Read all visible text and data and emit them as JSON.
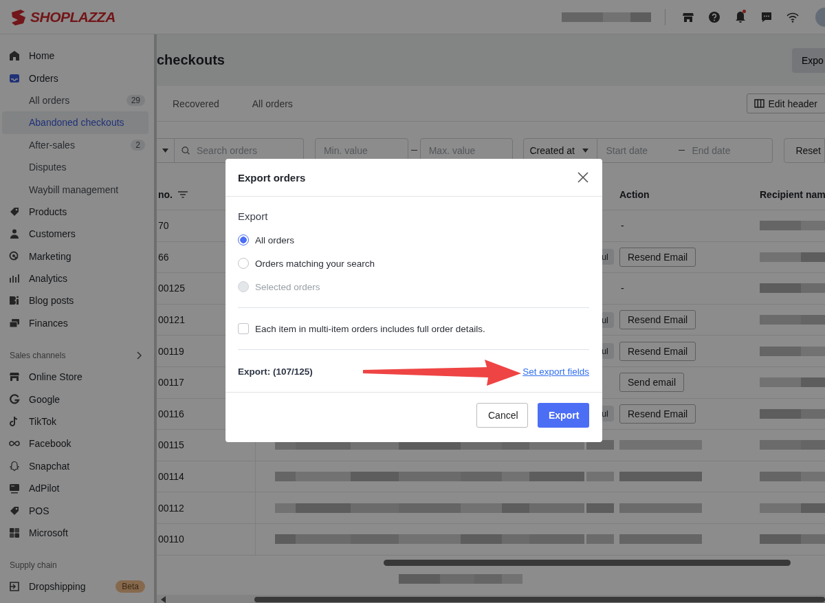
{
  "topbar": {
    "brand": "SHOPLAZZA",
    "unread_notifications": true
  },
  "sidebar": {
    "items": [
      {
        "label": "Home",
        "selected": false
      },
      {
        "label": "Orders",
        "selected": false,
        "children": [
          {
            "label": "All orders",
            "count": "29",
            "selected": false
          },
          {
            "label": "Abandoned checkouts",
            "selected": true
          },
          {
            "label": "After-sales",
            "count": "2",
            "selected": false
          },
          {
            "label": "Disputes",
            "selected": false
          },
          {
            "label": "Waybill management",
            "selected": false
          }
        ]
      },
      {
        "label": "Products",
        "selected": false
      },
      {
        "label": "Customers",
        "selected": false
      },
      {
        "label": "Marketing",
        "selected": false
      },
      {
        "label": "Analytics",
        "selected": false
      },
      {
        "label": "Blog posts",
        "selected": false
      },
      {
        "label": "Finances",
        "selected": false
      }
    ],
    "sections": [
      {
        "title": "Sales channels",
        "items": [
          {
            "label": "Online Store",
            "selected": false
          },
          {
            "label": "Google",
            "selected": false
          },
          {
            "label": "TikTok",
            "selected": false
          },
          {
            "label": "Facebook",
            "selected": false
          },
          {
            "label": "Snapchat",
            "selected": false
          },
          {
            "label": "AdPilot",
            "selected": false
          },
          {
            "label": "POS",
            "selected": false
          },
          {
            "label": "Microsoft",
            "selected": false
          }
        ]
      },
      {
        "title": "Supply chain",
        "items": [
          {
            "label": "Dropshipping",
            "badge": "Beta",
            "selected": false
          }
        ]
      }
    ]
  },
  "page": {
    "title": "checkouts",
    "header_button": "Expo",
    "tabs": [
      {
        "label": "Recovered",
        "selected": false
      },
      {
        "label": "All orders",
        "selected": false
      }
    ],
    "edit_header_button": "Edit header",
    "filters": {
      "search": {
        "placeholder": "Search orders"
      },
      "min_value": {
        "placeholder": "Min. value"
      },
      "max_value": {
        "placeholder": "Max. value"
      },
      "date_type": "Created at",
      "start_date": {
        "placeholder": "Start date"
      },
      "end_date": {
        "placeholder": "End date"
      },
      "reset_button": "Reset"
    },
    "table": {
      "columns": [
        {
          "label": "no."
        },
        {
          "label": "Action"
        },
        {
          "label": "Recipient nam"
        }
      ],
      "rows": [
        {
          "order_no": "70",
          "action": {
            "kind": "text",
            "label": "-"
          },
          "redacted": false
        },
        {
          "order_no": "66",
          "status": "ul",
          "action": {
            "kind": "button",
            "label": "Resend Email"
          },
          "redacted": false
        },
        {
          "order_no": "00125",
          "action": {
            "kind": "text",
            "label": "-"
          },
          "redacted": false
        },
        {
          "order_no": "00121",
          "status": "ul",
          "action": {
            "kind": "button",
            "label": "Resend Email"
          },
          "redacted": false
        },
        {
          "order_no": "00119",
          "status": "ul",
          "action": {
            "kind": "button",
            "label": "Resend Email"
          },
          "redacted": false
        },
        {
          "order_no": "00117",
          "action": {
            "kind": "button",
            "label": "Send email"
          },
          "redacted": false
        },
        {
          "order_no": "00116",
          "status": "ul",
          "action": {
            "kind": "button",
            "label": "Resend Email"
          },
          "redacted": false
        },
        {
          "order_no": "00115",
          "redacted": true
        },
        {
          "order_no": "00114",
          "redacted": true
        },
        {
          "order_no": "00112",
          "redacted": true
        },
        {
          "order_no": "00110",
          "redacted": true
        }
      ]
    }
  },
  "modal": {
    "title": "Export orders",
    "section_label": "Export",
    "options": [
      {
        "label": "All orders",
        "selected": true,
        "disabled": false
      },
      {
        "label": "Orders matching your search",
        "selected": false,
        "disabled": false
      },
      {
        "label": "Selected orders",
        "selected": false,
        "disabled": true
      }
    ],
    "checkbox": {
      "label": "Each item in multi-item orders includes full order details.",
      "checked": false
    },
    "count": "Export: (107/125)",
    "fields_link": "Set export fields",
    "buttons": [
      {
        "label": "Cancel",
        "kind": "secondary"
      },
      {
        "label": "Export",
        "kind": "primary"
      }
    ]
  }
}
